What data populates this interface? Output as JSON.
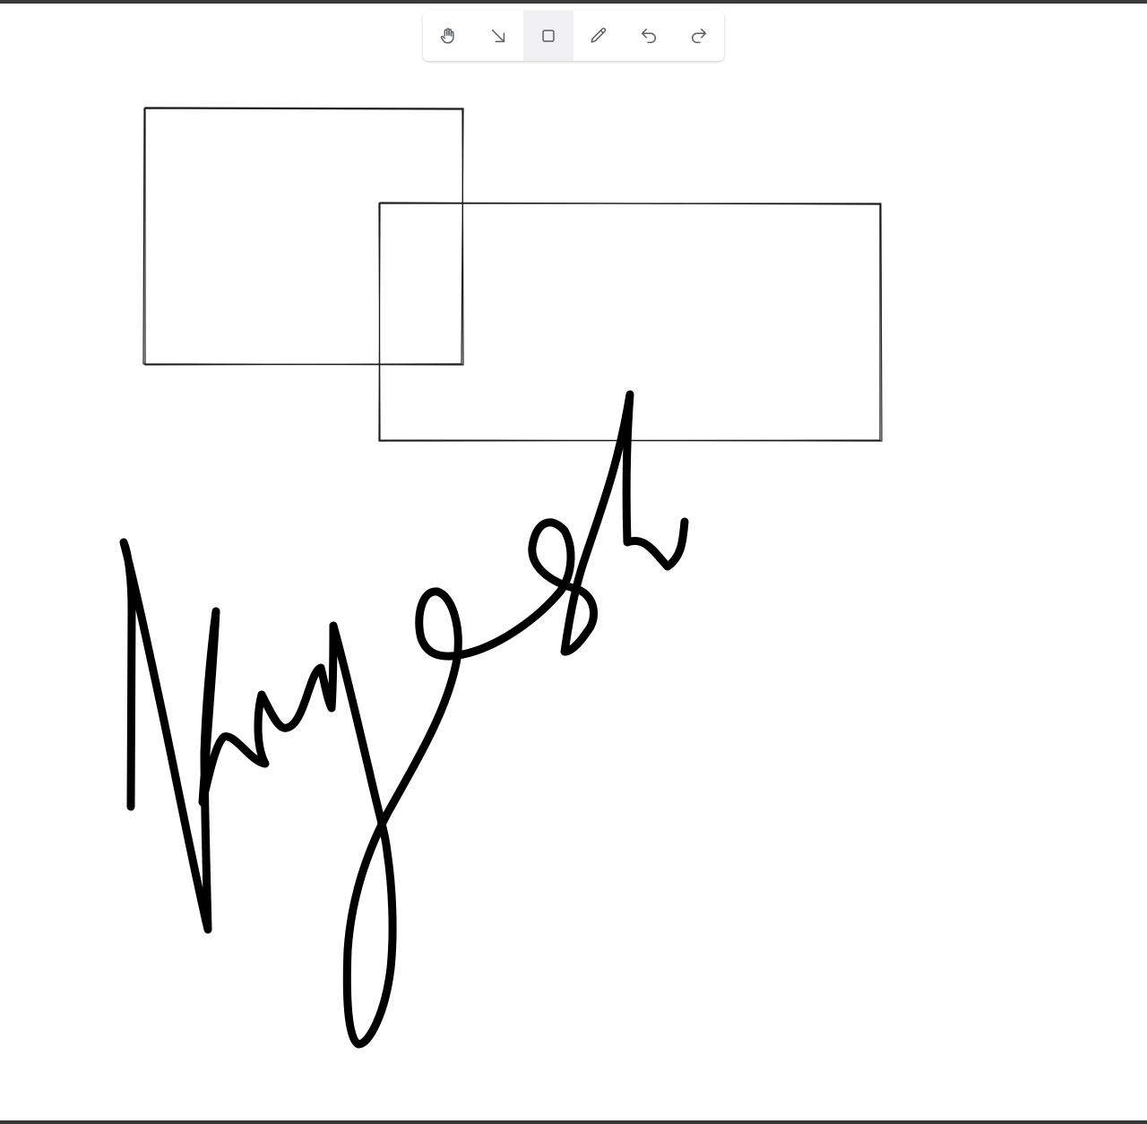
{
  "toolbar": {
    "tools": [
      {
        "id": "hand",
        "icon": "hand-icon",
        "active": false
      },
      {
        "id": "arrow",
        "icon": "arrow-down-right-icon",
        "active": false
      },
      {
        "id": "rectangle",
        "icon": "square-icon",
        "active": true
      },
      {
        "id": "pencil",
        "icon": "pencil-icon",
        "active": false
      },
      {
        "id": "undo",
        "icon": "undo-icon",
        "active": false
      },
      {
        "id": "redo",
        "icon": "redo-icon",
        "active": false
      }
    ]
  },
  "canvas": {
    "background": "#ffffff",
    "stroke_color": "#000000",
    "shapes": [
      {
        "type": "rectangle"
      },
      {
        "type": "rectangle"
      },
      {
        "type": "freehand"
      }
    ]
  },
  "colors": {
    "frame_border": "#3a3a3a",
    "active_tool_bg": "#f1f1f4",
    "icon_color": "#5b5d67"
  }
}
